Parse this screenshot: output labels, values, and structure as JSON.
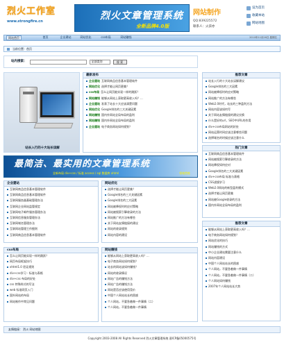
{
  "header": {
    "logo_title": "烈火工作室",
    "logo_url": "www.strongfire.cn",
    "banner_title": "烈火文章管理系统",
    "banner_sub": "全新品牌4.0版",
    "hq_title": "网站制作",
    "qq": "QQ:839225572",
    "contact": "联系人：火孩亦",
    "links": [
      "设为首页",
      "收藏本站",
      "网站地图"
    ]
  },
  "nav": {
    "home": "网站首页",
    "items": [
      "首页",
      "企业建站",
      "网站优化",
      "css布局",
      "网站赚钱"
    ],
    "date": "2010年11月26日 星期五"
  },
  "crumb": "当前位置：首页",
  "search": {
    "label": "站内搜索：",
    "select": "全部类别",
    "button": "搜 索"
  },
  "pc_caption": "站长入行的十大站长误解",
  "recommend": {
    "title": "最新发布",
    "rows": [
      {
        "tag": "企业建站",
        "text": "互联网商品信息基本管理软件"
      },
      {
        "tag": "网站优化",
        "text": "选择才能让网页更美？"
      },
      {
        "tag": "css布局",
        "text": "怎么让网页能实现一样的跳跃？"
      },
      {
        "tag": "网站赚钱",
        "text": "能够从网站上获取更高收入吗？..."
      },
      {
        "tag": "企业建站",
        "text": "发表了站长十大应该清楚问题"
      },
      {
        "tag": "网站优化",
        "text": "Google排名的三大关键因素"
      },
      {
        "tag": "网站赚钱",
        "text": "国内外网站全局布局的盈利"
      },
      {
        "tag": "网站赚钱",
        "text": "国内外网站全局布局的盈利"
      },
      {
        "tag": "企业建站",
        "text": "电子商务网站如何规划？"
      }
    ]
  },
  "slogan": {
    "text": "最简洁、最实用的文章管理系统",
    "sub": "全新布局 div+css / 标准 access / sql 数据库 xhtml",
    "right": "领域首推"
  },
  "right_panels": [
    {
      "title": "推荐文章",
      "rows": [
        "站长入行的十大站长误解建议",
        "Google排名的三大因素",
        "网站被降权时的应对策略",
        "网站推广的方法有哪些",
        "Web2.0时代，站长的三种盈利方法",
        "网站内容该如何写",
        "关于网站友情链接的建议交换",
        "什么是好的url，SEO中URL的作用",
        "div+css布局网站的好处",
        "网站运营时间应该注意哪些问题",
        "选择域名的时候应该注意什么"
      ]
    },
    {
      "title": "热门文章",
      "rows": [
        "互联网商品信息基本管理软件",
        "网站被搜索引擎收录的方法",
        "网站降权如何应对",
        "Google排名的三大关键因素",
        "div+css布局 标准与表格",
        "CSS滤镜学习",
        "Web2.0网站的新型盈利模式",
        "选择才能让网页更美",
        "网站被Google收录的方法",
        "国内外网站全局布局的盈利"
      ]
    },
    {
      "title": "推荐文章",
      "rows": [
        "能够从网站上获取更高收入吗？...",
        "电子商务网站如何规划？",
        "网站优化的技巧",
        "网站赚钱的方式",
        "中小企业建站需要注意什么",
        "网站内容建设",
        "中国个人网站站长的困惑",
        "个人网站，不要急着做一件事情",
        "个人网站，不要急着做一件事情（二）",
        "个人网站如何赚钱",
        "2007年个人网站站长大势"
      ]
    }
  ],
  "bottom_panels": [
    {
      "title": "企业建站",
      "rows": [
        "互联网商品信息基本管理软件",
        "互联网商品信息基本管理软件",
        "互联网服务器基础管理办法",
        "互联网企业网站监管规定",
        "互联网电子邮件服务管理办法",
        "互联网信息服务管理办法",
        "互联网域名管理办法",
        "互联网站管理工作细则",
        "互联网商品信息基本管理软件"
      ]
    },
    {
      "title": "网站优化",
      "rows": [
        "选择才能让网页更美？",
        "Google排名的三大关键因素",
        "Google排名的三大因素",
        "网站被降权时的应对策略",
        "网站被搜索引擎收录的方法",
        "网站推广的方法有哪些",
        "关于网站友情链接的建议",
        "网站的收录规则",
        "网站内容的建设"
      ]
    },
    {
      "title": "css布局",
      "rows": [
        "怎么让网页能实现一样的跳跃？",
        "网页布局框架技巧",
        "xhtml1.0 验证规则",
        "div+css学习 - 标准与表格",
        "div+css 布局的好处",
        "css 特殊样式的写法",
        "web 标准网页入门",
        "国外网站的布局",
        "网站制作中常见问题"
      ]
    },
    {
      "title": "网站赚钱",
      "rows": [
        "能够从网站上获取更高收入吗？...",
        "电子商务网站如何规划？",
        "站长的网站该如何赚钱？",
        "网站的收录情况",
        "网站广告的赚钱方法",
        "网站广告的赚钱方法",
        "网站是否应该使用竞价",
        "中国个人网站站长的困惑",
        "个人网站，不要急着做一件事情（二）",
        "个人网站，不要急着做一件事情"
      ]
    }
  ],
  "footer": {
    "links": "友情链接：  烈火    网站地图",
    "copyright": "Copyright 2003-2008 All Rights Reserved  烈火文章管理系统  晋ICP备05000575号"
  }
}
